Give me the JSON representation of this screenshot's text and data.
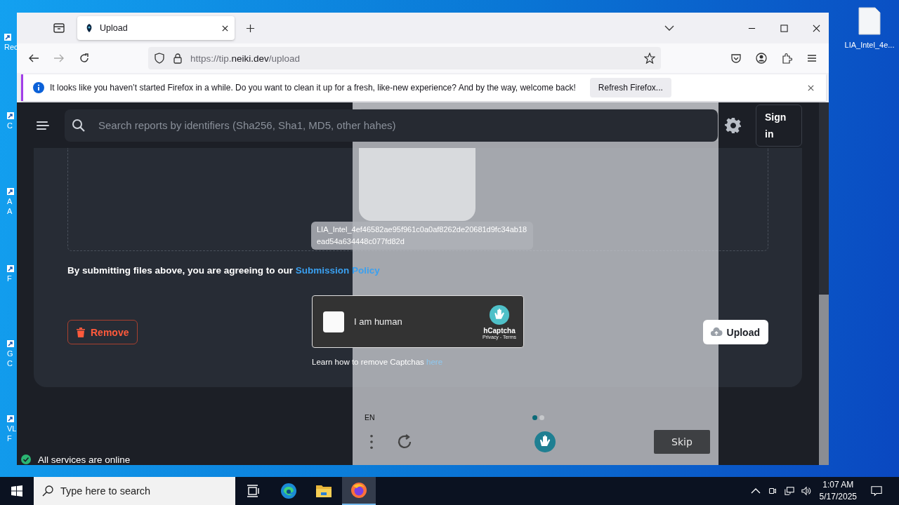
{
  "desktop": {
    "left_icons": [
      {
        "lines": [
          "Rec"
        ]
      },
      {
        "lines": [
          "C"
        ]
      },
      {
        "lines": [
          "A",
          "A"
        ]
      },
      {
        "lines": [
          "F"
        ]
      },
      {
        "lines": [
          "G",
          "C"
        ]
      },
      {
        "lines": [
          "VL",
          "F"
        ]
      }
    ],
    "right_icon": {
      "label": "LIA_Intel_4e..."
    }
  },
  "browser": {
    "tabs": [
      {
        "title": "Upload",
        "selected": true
      }
    ],
    "url": {
      "scheme": "https://tip.",
      "domain": "neiki.dev",
      "path": "/upload"
    },
    "notification": {
      "message": "It looks like you haven’t started Firefox in a while. Do you want to clean it up for a fresh, like-new experience? And by the way, welcome back!",
      "button": "Refresh Firefox..."
    }
  },
  "page": {
    "search": {
      "placeholder": "Search reports by identifiers (Sha256, Sha1, MD5, other hahes)"
    },
    "sign_in": "Sign in",
    "agreement": {
      "text": "By submitting files above, you are agreeing to our",
      "link": "Submission Policy"
    },
    "remove": "Remove",
    "captcha": {
      "checked": false,
      "label": "I am human",
      "brand": "hCaptcha",
      "links": "Privacy - Terms",
      "learn": "Learn how to remove Captchas",
      "learn_link": "here"
    },
    "upload": "Upload",
    "status": "All services are online"
  },
  "challenge": {
    "filename": "LIA_Intel_4ef46582ae95f961c0a0af8262de20681d9fc34ab18ead54a634448c077fd82d",
    "language": "EN",
    "pages": [
      {
        "selected": true
      },
      {
        "selected": false
      }
    ],
    "skip": "Skip"
  },
  "taskbar": {
    "search_placeholder": "Type here to search",
    "apps": [
      {
        "kind": "edge",
        "selected": false
      },
      {
        "kind": "explorer",
        "selected": false
      },
      {
        "kind": "firefox",
        "selected": true
      }
    ],
    "time": "1:07 AM",
    "date": "5/17/2025"
  }
}
